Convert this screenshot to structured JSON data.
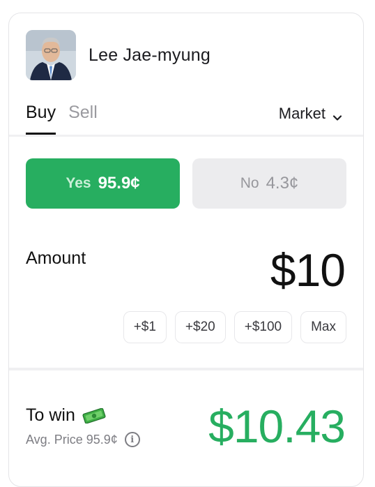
{
  "market": {
    "title": "Lee Jae-myung",
    "avatar_icon": "candidate-portrait"
  },
  "tabs": [
    {
      "label": "Buy",
      "active": true
    },
    {
      "label": "Sell",
      "active": false
    }
  ],
  "order_type": {
    "label": "Market",
    "icon": "chevron-down-icon"
  },
  "outcomes": {
    "yes": {
      "label": "Yes",
      "price": "95.9¢",
      "color": "#27ae60"
    },
    "no": {
      "label": "No",
      "price": "4.3¢",
      "color": "#ececee"
    }
  },
  "amount": {
    "label": "Amount",
    "value": "$10"
  },
  "quick_amounts": [
    "+$1",
    "+$20",
    "+$100",
    "Max"
  ],
  "payout": {
    "label": "To win",
    "icon": "money-icon",
    "avg_price_text": "Avg. Price 95.9¢",
    "value": "$10.43",
    "value_color": "#27ae60"
  }
}
